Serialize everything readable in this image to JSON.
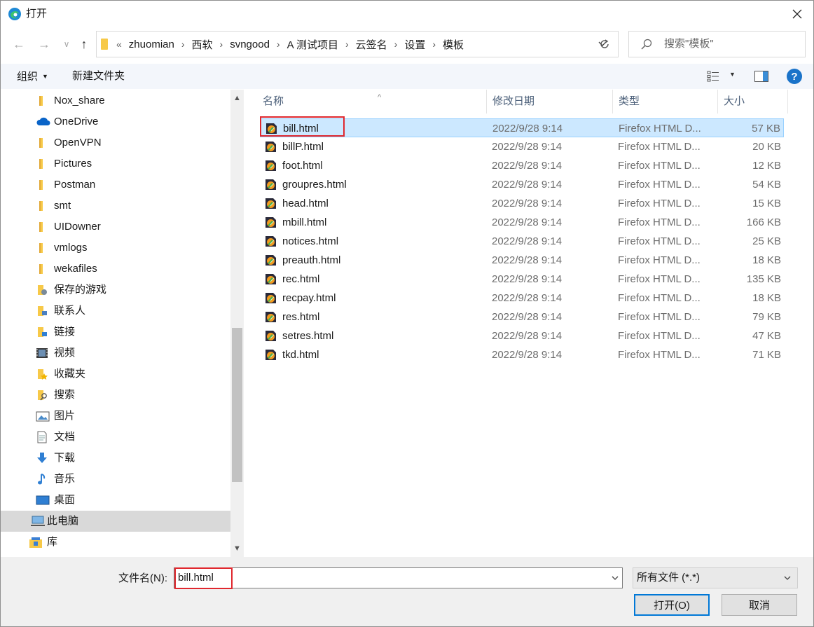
{
  "window": {
    "title": "打开"
  },
  "nav_buttons": {
    "back": "←",
    "forward": "→",
    "recent": "∨",
    "up": "↑"
  },
  "address": {
    "lead": "«",
    "crumbs": [
      "zhuomian",
      "西软",
      "svngood",
      "A 测试项目",
      "云签名",
      "设置",
      "模板"
    ],
    "separator": "›"
  },
  "search": {
    "placeholder": "搜索\"模板\""
  },
  "toolbar": {
    "organize": "组织",
    "new_folder": "新建文件夹"
  },
  "nav": {
    "items": [
      {
        "label": "Nox_share",
        "icon": "folder-icon"
      },
      {
        "label": "OneDrive",
        "icon": "cloud-icon"
      },
      {
        "label": "OpenVPN",
        "icon": "folder-icon"
      },
      {
        "label": "Pictures",
        "icon": "folder-icon"
      },
      {
        "label": "Postman",
        "icon": "folder-icon"
      },
      {
        "label": "smt",
        "icon": "folder-icon"
      },
      {
        "label": "UIDowner",
        "icon": "folder-icon"
      },
      {
        "label": "vmlogs",
        "icon": "folder-icon"
      },
      {
        "label": "wekafiles",
        "icon": "folder-icon"
      },
      {
        "label": "保存的游戏",
        "icon": "saved-games-icon"
      },
      {
        "label": "联系人",
        "icon": "contacts-icon"
      },
      {
        "label": "链接",
        "icon": "links-icon"
      },
      {
        "label": "视频",
        "icon": "videos-icon"
      },
      {
        "label": "收藏夹",
        "icon": "favorites-icon"
      },
      {
        "label": "搜索",
        "icon": "searches-icon"
      },
      {
        "label": "图片",
        "icon": "pictures-icon"
      },
      {
        "label": "文档",
        "icon": "documents-icon"
      },
      {
        "label": "下载",
        "icon": "downloads-icon"
      },
      {
        "label": "音乐",
        "icon": "music-icon"
      },
      {
        "label": "桌面",
        "icon": "desktop-icon"
      },
      {
        "label": "此电脑",
        "icon": "this-pc-icon",
        "selected": true
      },
      {
        "label": "库",
        "icon": "libraries-icon"
      }
    ]
  },
  "columns": {
    "name": "名称",
    "date": "修改日期",
    "type": "类型",
    "size": "大小"
  },
  "files": [
    {
      "name": "bill.html",
      "date": "2022/9/28 9:14",
      "type": "Firefox HTML D...",
      "size": "57 KB",
      "selected": true
    },
    {
      "name": "billP.html",
      "date": "2022/9/28 9:14",
      "type": "Firefox HTML D...",
      "size": "20 KB"
    },
    {
      "name": "foot.html",
      "date": "2022/9/28 9:14",
      "type": "Firefox HTML D...",
      "size": "12 KB"
    },
    {
      "name": "groupres.html",
      "date": "2022/9/28 9:14",
      "type": "Firefox HTML D...",
      "size": "54 KB"
    },
    {
      "name": "head.html",
      "date": "2022/9/28 9:14",
      "type": "Firefox HTML D...",
      "size": "15 KB"
    },
    {
      "name": "mbill.html",
      "date": "2022/9/28 9:14",
      "type": "Firefox HTML D...",
      "size": "166 KB"
    },
    {
      "name": "notices.html",
      "date": "2022/9/28 9:14",
      "type": "Firefox HTML D...",
      "size": "25 KB"
    },
    {
      "name": "preauth.html",
      "date": "2022/9/28 9:14",
      "type": "Firefox HTML D...",
      "size": "18 KB"
    },
    {
      "name": "rec.html",
      "date": "2022/9/28 9:14",
      "type": "Firefox HTML D...",
      "size": "135 KB"
    },
    {
      "name": "recpay.html",
      "date": "2022/9/28 9:14",
      "type": "Firefox HTML D...",
      "size": "18 KB"
    },
    {
      "name": "res.html",
      "date": "2022/9/28 9:14",
      "type": "Firefox HTML D...",
      "size": "79 KB"
    },
    {
      "name": "setres.html",
      "date": "2022/9/28 9:14",
      "type": "Firefox HTML D...",
      "size": "47 KB"
    },
    {
      "name": "tkd.html",
      "date": "2022/9/28 9:14",
      "type": "Firefox HTML D...",
      "size": "71 KB"
    }
  ],
  "footer": {
    "filename_label": "文件名(N):",
    "filename_value": "bill.html",
    "filter_value": "所有文件 (*.*)",
    "open_label": "打开(O)",
    "cancel_label": "取消"
  },
  "colors": {
    "accent": "#0078d7",
    "selection": "#cce8ff",
    "highlight_box": "#e0282e",
    "folder": "#f7c948"
  }
}
